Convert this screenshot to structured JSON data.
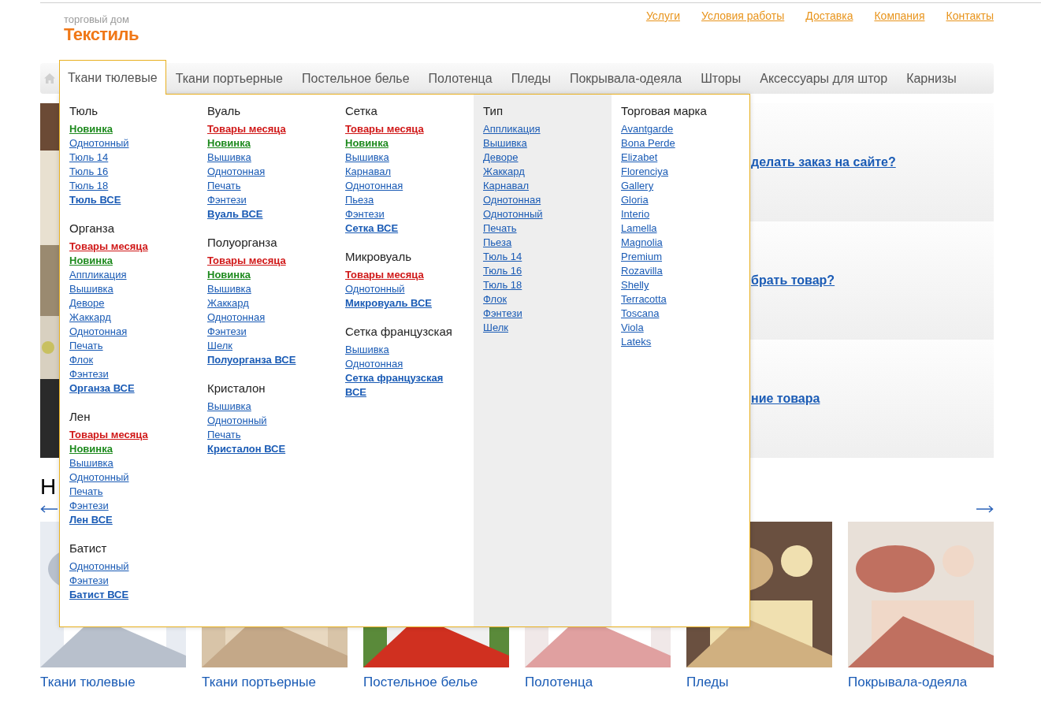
{
  "logo": {
    "tagline": "торговый дом",
    "name": "Текстиль"
  },
  "top_links": [
    "Услуги",
    "Условия работы",
    "Доставка",
    "Компания",
    "Контакты"
  ],
  "nav": [
    {
      "label": "Ткани тюлевые",
      "selected": true
    },
    {
      "label": "Ткани портьерные",
      "selected": false
    },
    {
      "label": "Постельное белье",
      "selected": false
    },
    {
      "label": "Полотенца",
      "selected": false
    },
    {
      "label": "Пледы",
      "selected": false
    },
    {
      "label": "Покрывала-одеяла",
      "selected": false
    },
    {
      "label": "Шторы",
      "selected": false
    },
    {
      "label": "Аксессуары для штор",
      "selected": false
    },
    {
      "label": "Карнизы",
      "selected": false
    }
  ],
  "menu": {
    "columns": [
      {
        "shaded": false,
        "groups": [
          {
            "title": "Тюль",
            "items": [
              {
                "label": "Новинка",
                "kind": "new"
              },
              {
                "label": "Однотонный",
                "kind": "link"
              },
              {
                "label": "Тюль 14",
                "kind": "link"
              },
              {
                "label": "Тюль 16",
                "kind": "link"
              },
              {
                "label": "Тюль 18",
                "kind": "link"
              },
              {
                "label": "Тюль ВСЕ",
                "kind": "all"
              }
            ]
          },
          {
            "title": "Органза",
            "items": [
              {
                "label": "Товары месяца",
                "kind": "month"
              },
              {
                "label": "Новинка",
                "kind": "new"
              },
              {
                "label": "Аппликация",
                "kind": "link"
              },
              {
                "label": "Вышивка",
                "kind": "link"
              },
              {
                "label": "Деворе",
                "kind": "link"
              },
              {
                "label": "Жаккард",
                "kind": "link"
              },
              {
                "label": "Однотонная",
                "kind": "link"
              },
              {
                "label": "Печать",
                "kind": "link"
              },
              {
                "label": "Флок",
                "kind": "link"
              },
              {
                "label": "Фэнтези",
                "kind": "link"
              },
              {
                "label": "Органза ВСЕ",
                "kind": "all"
              }
            ]
          },
          {
            "title": "Лен",
            "items": [
              {
                "label": "Товары месяца",
                "kind": "month"
              },
              {
                "label": "Новинка",
                "kind": "new"
              },
              {
                "label": "Вышивка",
                "kind": "link"
              },
              {
                "label": "Однотонный",
                "kind": "link"
              },
              {
                "label": "Печать",
                "kind": "link"
              },
              {
                "label": "Фэнтези",
                "kind": "link"
              },
              {
                "label": "Лен ВСЕ",
                "kind": "all"
              }
            ]
          },
          {
            "title": "Батист",
            "items": [
              {
                "label": "Однотонный",
                "kind": "link"
              },
              {
                "label": "Фэнтези",
                "kind": "link"
              },
              {
                "label": "Батист ВСЕ",
                "kind": "all"
              }
            ]
          }
        ]
      },
      {
        "shaded": false,
        "groups": [
          {
            "title": "Вуаль",
            "items": [
              {
                "label": "Товары месяца",
                "kind": "month"
              },
              {
                "label": "Новинка",
                "kind": "new"
              },
              {
                "label": "Вышивка",
                "kind": "link"
              },
              {
                "label": "Однотонная",
                "kind": "link"
              },
              {
                "label": "Печать",
                "kind": "link"
              },
              {
                "label": "Фэнтези",
                "kind": "link"
              },
              {
                "label": "Вуаль ВСЕ",
                "kind": "all"
              }
            ]
          },
          {
            "title": "Полуорганза",
            "items": [
              {
                "label": "Товары месяца",
                "kind": "month"
              },
              {
                "label": "Новинка",
                "kind": "new"
              },
              {
                "label": "Вышивка",
                "kind": "link"
              },
              {
                "label": "Жаккард",
                "kind": "link"
              },
              {
                "label": "Однотонная",
                "kind": "link"
              },
              {
                "label": "Фэнтези",
                "kind": "link"
              },
              {
                "label": "Шелк",
                "kind": "link"
              },
              {
                "label": "Полуорганза ВСЕ",
                "kind": "all"
              }
            ]
          },
          {
            "title": "Кристалон",
            "items": [
              {
                "label": "Вышивка",
                "kind": "link"
              },
              {
                "label": "Однотонный",
                "kind": "link"
              },
              {
                "label": "Печать",
                "kind": "link"
              },
              {
                "label": "Кристалон ВСЕ",
                "kind": "all"
              }
            ]
          }
        ]
      },
      {
        "shaded": false,
        "groups": [
          {
            "title": "Сетка",
            "items": [
              {
                "label": "Товары месяца",
                "kind": "month"
              },
              {
                "label": "Новинка",
                "kind": "new"
              },
              {
                "label": "Вышивка",
                "kind": "link"
              },
              {
                "label": "Карнавал",
                "kind": "link"
              },
              {
                "label": "Однотонная",
                "kind": "link"
              },
              {
                "label": "Пьеза",
                "kind": "link"
              },
              {
                "label": "Фэнтези",
                "kind": "link"
              },
              {
                "label": "Сетка ВСЕ",
                "kind": "all"
              }
            ]
          },
          {
            "title": "Микровуаль",
            "items": [
              {
                "label": "Товары месяца",
                "kind": "month"
              },
              {
                "label": "Однотонный",
                "kind": "link"
              },
              {
                "label": "Микровуаль ВСЕ",
                "kind": "all"
              }
            ]
          },
          {
            "title": "Сетка французская",
            "items": [
              {
                "label": "Вышивка",
                "kind": "link"
              },
              {
                "label": "Однотонная",
                "kind": "link"
              },
              {
                "label": "Сетка французская ВСЕ",
                "kind": "all"
              }
            ]
          }
        ]
      },
      {
        "shaded": true,
        "groups": [
          {
            "title": "Тип",
            "items": [
              {
                "label": "Аппликация",
                "kind": "link"
              },
              {
                "label": "Вышивка",
                "kind": "link"
              },
              {
                "label": "Деворе",
                "kind": "link"
              },
              {
                "label": "Жаккард",
                "kind": "link"
              },
              {
                "label": "Карнавал",
                "kind": "link"
              },
              {
                "label": "Однотонная",
                "kind": "link"
              },
              {
                "label": "Однотонный",
                "kind": "link"
              },
              {
                "label": "Печать",
                "kind": "link"
              },
              {
                "label": "Пьеза",
                "kind": "link"
              },
              {
                "label": "Тюль 14",
                "kind": "link"
              },
              {
                "label": "Тюль 16",
                "kind": "link"
              },
              {
                "label": "Тюль 18",
                "kind": "link"
              },
              {
                "label": "Флок",
                "kind": "link"
              },
              {
                "label": "Фэнтези",
                "kind": "link"
              },
              {
                "label": "Шелк",
                "kind": "link"
              }
            ]
          }
        ]
      },
      {
        "shaded": false,
        "groups": [
          {
            "title": "Торговая марка",
            "items": [
              {
                "label": "Avantgarde",
                "kind": "link"
              },
              {
                "label": "Bona Perde",
                "kind": "link"
              },
              {
                "label": "Elizabet",
                "kind": "link"
              },
              {
                "label": "Florenciya",
                "kind": "link"
              },
              {
                "label": "Gallery",
                "kind": "link"
              },
              {
                "label": "Gloria",
                "kind": "link"
              },
              {
                "label": "Interio",
                "kind": "link"
              },
              {
                "label": "Lamella",
                "kind": "link"
              },
              {
                "label": "Magnolia",
                "kind": "link"
              },
              {
                "label": "Premium",
                "kind": "link"
              },
              {
                "label": "Rozavilla",
                "kind": "link"
              },
              {
                "label": "Shelly",
                "kind": "link"
              },
              {
                "label": "Terracotta",
                "kind": "link"
              },
              {
                "label": "Toscana",
                "kind": "link"
              },
              {
                "label": "Viola",
                "kind": "link"
              },
              {
                "label": "Lateks",
                "kind": "link"
              }
            ]
          }
        ]
      }
    ]
  },
  "info_links": [
    "делать заказ на сайте?",
    "брать товар?",
    "ние товара"
  ],
  "section_heading": "Н",
  "products": [
    {
      "label": "Ткани тюлевые"
    },
    {
      "label": "Ткани портьерные"
    },
    {
      "label": "Постельное белье"
    },
    {
      "label": "Полотенца"
    },
    {
      "label": "Пледы"
    },
    {
      "label": "Покрывала-одеяла"
    }
  ]
}
